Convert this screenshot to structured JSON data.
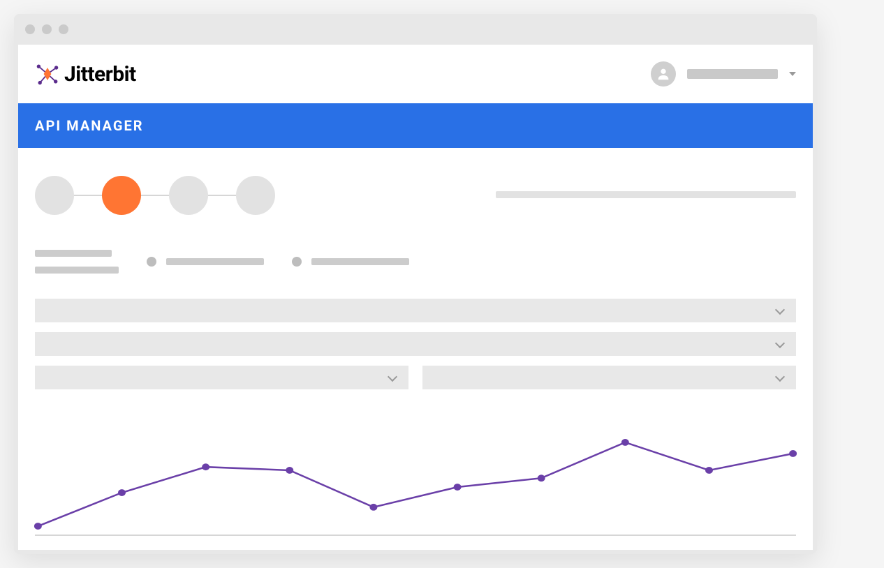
{
  "header": {
    "logo_text": "Jitterbit"
  },
  "banner": {
    "title": "API MANAGER"
  },
  "stepper": {
    "steps": [
      {
        "active": false
      },
      {
        "active": true
      },
      {
        "active": false
      },
      {
        "active": false
      }
    ]
  },
  "colors": {
    "accent_orange": "#ff7533",
    "banner_blue": "#2970e6",
    "chart_purple": "#6a3fa8"
  },
  "chart_data": {
    "type": "line",
    "x": [
      0,
      1,
      2,
      3,
      4,
      5,
      6,
      7,
      8,
      9
    ],
    "values": [
      5,
      35,
      58,
      55,
      22,
      40,
      48,
      80,
      55,
      70
    ],
    "ylim": [
      0,
      100
    ],
    "title": "",
    "xlabel": "",
    "ylabel": ""
  }
}
